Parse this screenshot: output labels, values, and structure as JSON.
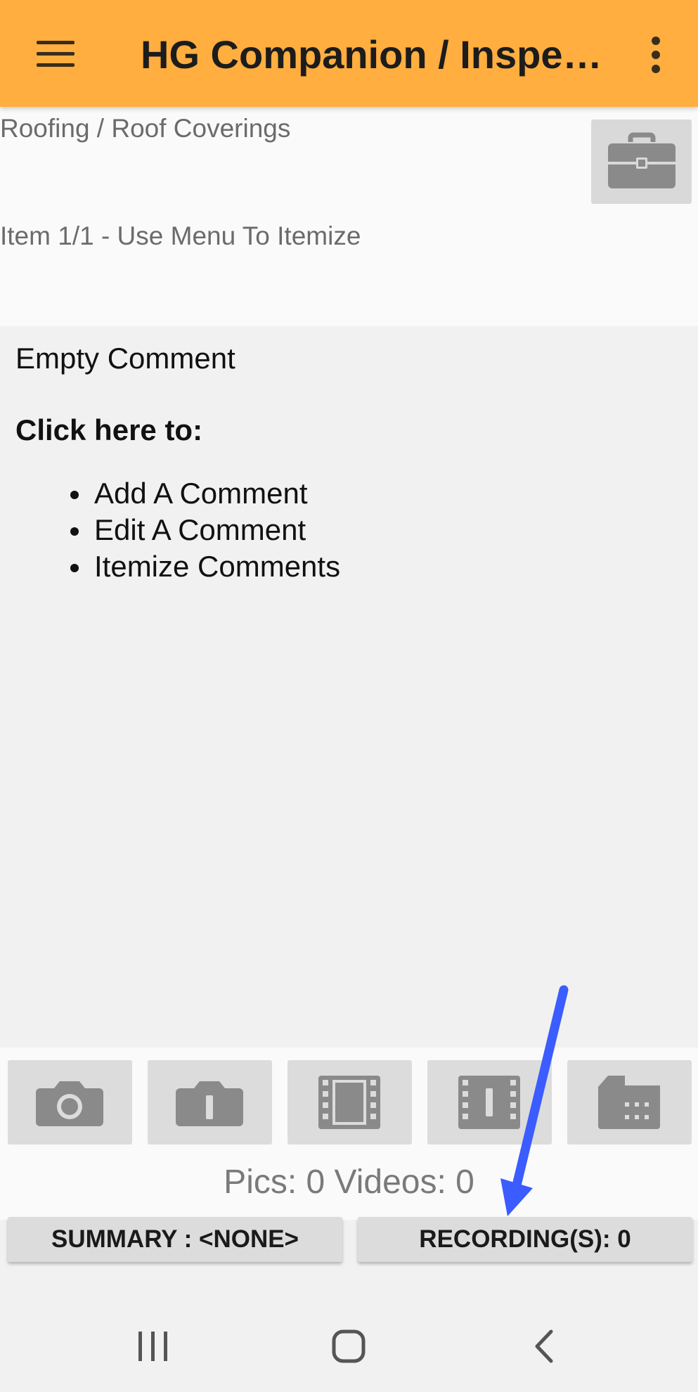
{
  "appbar": {
    "title": "HG Companion / Inspect…",
    "menu_icon": "hamburger-menu-icon",
    "overflow_icon": "more-vert-icon",
    "background": "#ffae3f"
  },
  "header": {
    "breadcrumb": "Roofing / Roof Coverings",
    "item_info": "Item 1/1 - Use Menu To Itemize",
    "briefcase_icon": "briefcase-icon"
  },
  "comment": {
    "empty_text": "Empty Comment",
    "click_here": "Click here to:",
    "options": [
      "Add A Comment",
      "Edit A Comment",
      "Itemize Comments"
    ]
  },
  "media": {
    "buttons": [
      "camera-icon",
      "camera-alt-icon",
      "video-icon",
      "video-alt-icon",
      "sd-card-icon"
    ],
    "counts": "Pics: 0 Videos: 0"
  },
  "actions": {
    "summary_label": "SUMMARY : <NONE>",
    "recording_label": "RECORDING(S): 0"
  },
  "annotation": {
    "arrow_color": "#3b5cff"
  },
  "navbar": [
    "recent-apps-icon",
    "home-icon",
    "back-icon"
  ]
}
